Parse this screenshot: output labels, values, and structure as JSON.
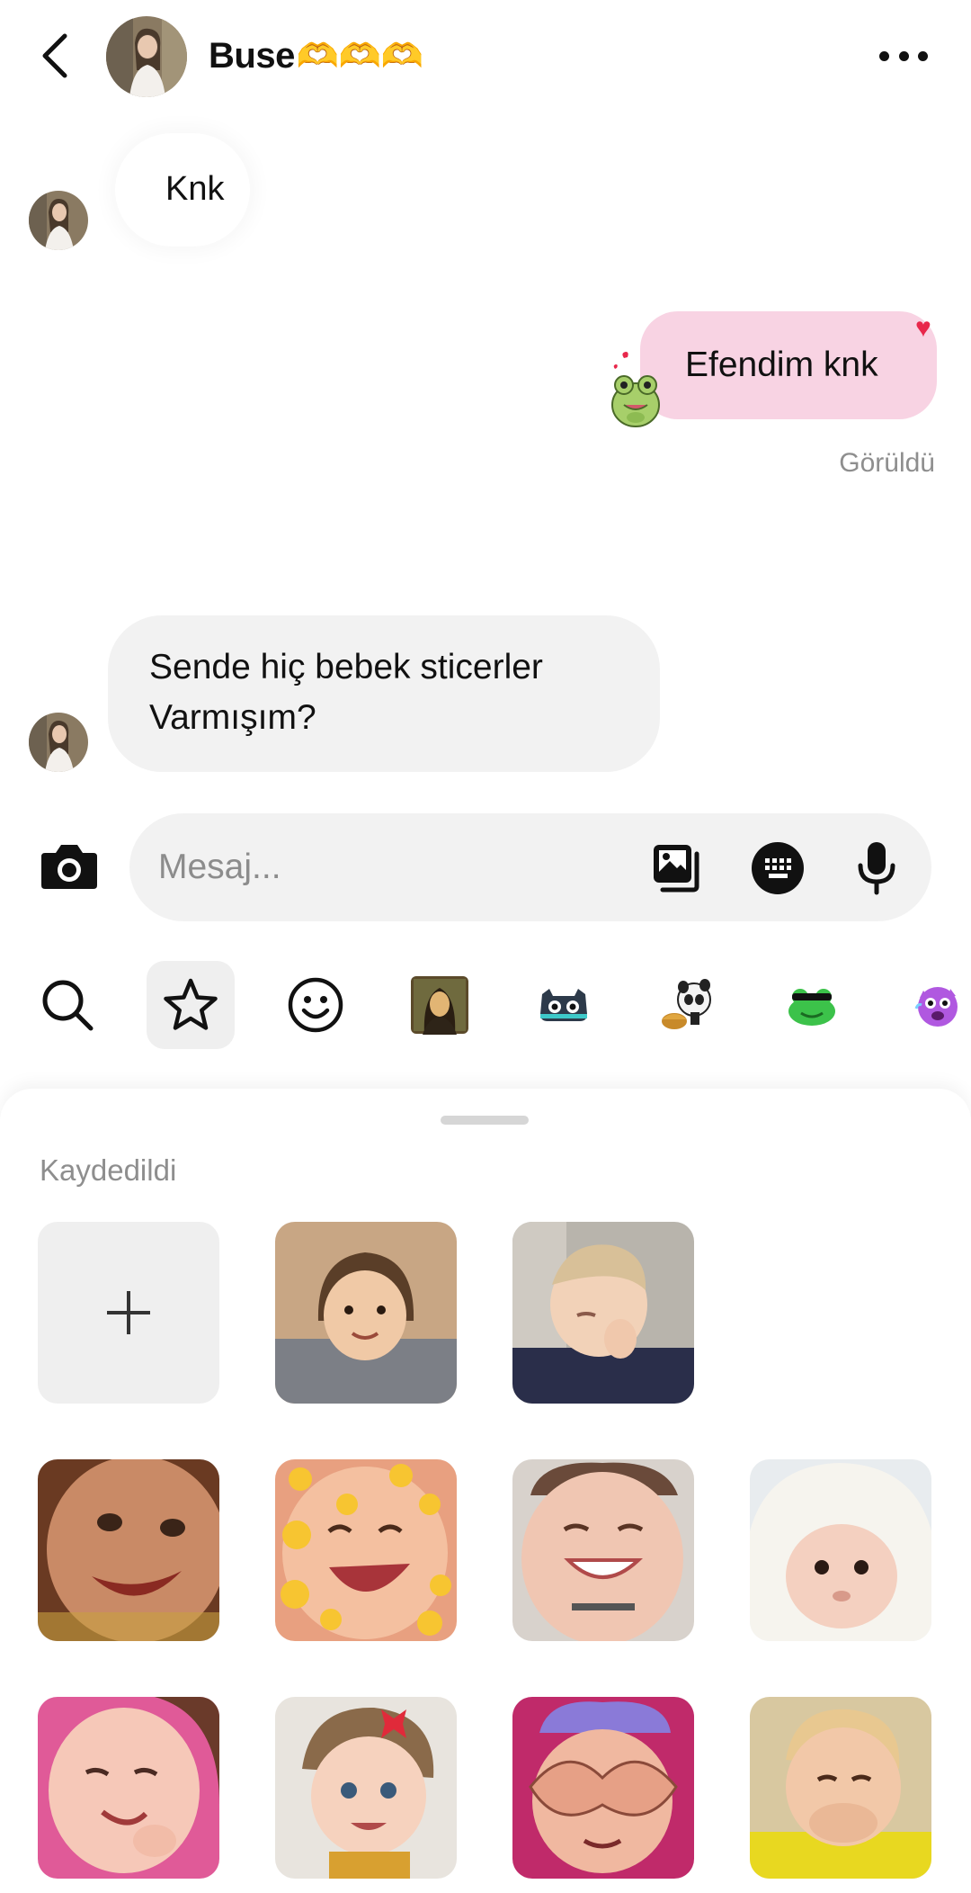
{
  "header": {
    "back_icon": "chevron-left-icon",
    "name": "Buse",
    "name_emoji": "🫶🫶🫶",
    "more_icon": "more-horizontal-icon"
  },
  "messages": [
    {
      "direction": "incoming",
      "text": "Knk"
    },
    {
      "direction": "outgoing",
      "text": "Efendim knk",
      "reaction": "heart",
      "status": "Görüldü"
    },
    {
      "direction": "incoming",
      "lines": [
        "Sende hiç bebek sticerler",
        "Varmışım?"
      ]
    }
  ],
  "composer": {
    "placeholder": "Mesaj...",
    "icons": [
      "camera-icon",
      "gallery-icon",
      "sticker-keyboard-icon",
      "microphone-icon"
    ]
  },
  "sticker_tabs": [
    "search",
    "favorites",
    "emoji",
    "mona-lisa-pack",
    "monster-pack",
    "panda-pack",
    "frog-pack",
    "purple-pack"
  ],
  "sticker_sheet": {
    "section_label": "Kaydedildi",
    "add_label": "+",
    "sticker_count": 10
  },
  "colors": {
    "outgoing_bubble": "#f8d3e3",
    "incoming_bubble": "#f2f2f2",
    "seen_text": "#8e8e8e",
    "heart": "#e8274b"
  }
}
